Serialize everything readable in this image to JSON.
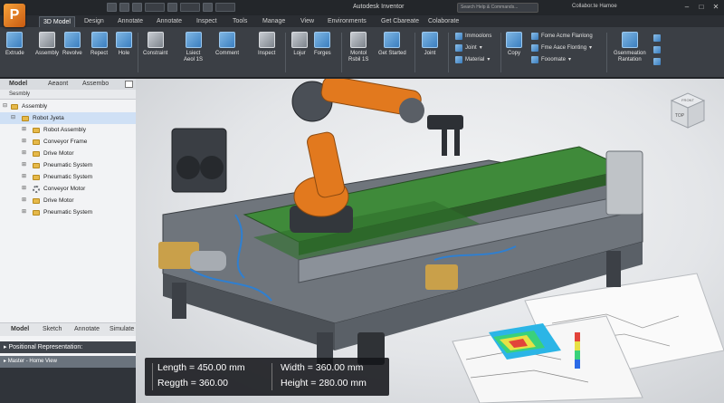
{
  "app": {
    "logo_letter": "P",
    "window_title": "Autodesk Inventor",
    "search_placeholder": "Search Help & Commands...",
    "sign_in": "Collabor.te Hamoe",
    "qat_field_1": "",
    "qat_field_2": "",
    "qat_field_3": ""
  },
  "tabs": [
    {
      "label": "3D Model",
      "active": true
    },
    {
      "label": "Design"
    },
    {
      "label": "Annotate"
    },
    {
      "label": "Annotate"
    },
    {
      "label": "Inspect"
    },
    {
      "label": "Tools"
    },
    {
      "label": "Manage"
    },
    {
      "label": "View"
    },
    {
      "label": "Environments"
    },
    {
      "label": "Get Cbareate"
    },
    {
      "label": "Colaborate"
    }
  ],
  "ribbon": {
    "extrude": "Extrude",
    "assembly": "Assembly",
    "revolve": "Revolve",
    "repeat": "Repect",
    "hole": "Hole",
    "constraint": "Constraint",
    "joint_line1": "Lsiect",
    "joint_line2": "Aeol 1S",
    "comment": "Comment",
    "inspect": "Inspect",
    "loop": "Lojur",
    "forges": "Forges",
    "manual_line1": "Montol",
    "manual_line2": "Rsbil 1S",
    "get_started": "Get Started",
    "joint": "Joint",
    "list_items": [
      "Immoolons",
      "Joint",
      "Material"
    ],
    "copy": "Copy",
    "format_items": [
      "Fome Acme Flanlong",
      "Fme Aace Flonting",
      "Fooomate"
    ],
    "gen_line1": "Gsenmeation",
    "gen_line2": "Rantation"
  },
  "browser": {
    "tabs": [
      "Model",
      "Aeaont",
      "Assembo"
    ],
    "head": "Sesmbly",
    "tree": [
      {
        "label": "Assembly",
        "indent": 0
      },
      {
        "label": "Robot Jyeta",
        "indent": 1,
        "selected": true
      },
      {
        "label": "Robot Assembly",
        "indent": 2
      },
      {
        "label": "Conveyor Frame",
        "indent": 2
      },
      {
        "label": "Drive Motor",
        "indent": 2
      },
      {
        "label": "Pneumatic System",
        "indent": 2
      },
      {
        "label": "Pneumatic System",
        "indent": 2
      },
      {
        "label": "Conveyor Motor",
        "indent": 2,
        "gear": true
      },
      {
        "label": "Drive Motor",
        "indent": 2
      },
      {
        "label": "Pneumatic System",
        "indent": 2
      }
    ],
    "bottom_tabs": [
      "Model",
      "Sketch",
      "Annotate",
      "Simulate"
    ],
    "positional": "Positional Representation:",
    "master": "Master - Home View"
  },
  "viewcube": {
    "top": "TOP",
    "front": "FRONT"
  },
  "dimensions": {
    "length": "Length = 450.00 mm",
    "reggth": "Reggth = 360.00",
    "width": "Width = 360.00 mm",
    "height": "Height = 280.00 mm"
  },
  "colors": {
    "accent": "#3b7fc0",
    "robot_orange": "#e2791e",
    "belt_green": "#3f8a3a",
    "ui_dark": "#2b2e33"
  }
}
